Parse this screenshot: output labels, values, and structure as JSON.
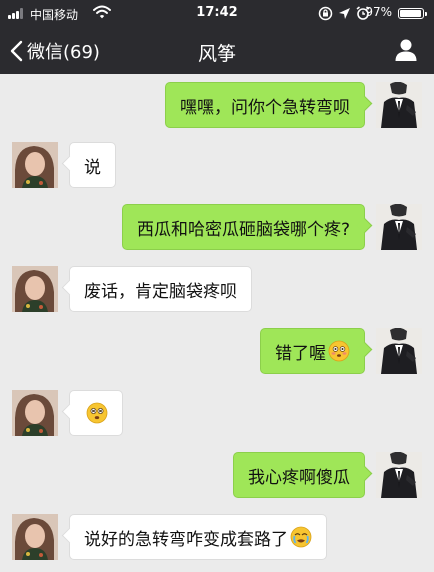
{
  "status_bar": {
    "carrier": "中国移动",
    "time": "17:42",
    "battery": "97%",
    "battery_level": 0.97,
    "icons": [
      "signal-bars-icon",
      "wifi-icon",
      "orientation-lock-icon",
      "location-arrow-icon",
      "alarm-icon",
      "battery-icon"
    ]
  },
  "nav": {
    "back_label": "微信(69)",
    "back_icon": "chevron-left-icon",
    "title": "风筝",
    "profile_icon": "person-icon"
  },
  "colors": {
    "nav_background": "#2b2b2f",
    "chat_background": "#ebebeb",
    "sent_bubble": "#9fe658",
    "received_bubble": "#ffffff"
  },
  "messages": [
    {
      "side": "right",
      "text": "嘿嘿，问你个急转弯呗",
      "emoji": ""
    },
    {
      "side": "left",
      "text": "说",
      "emoji": ""
    },
    {
      "side": "right",
      "text": "西瓜和哈密瓜砸脑袋哪个疼?",
      "emoji": ""
    },
    {
      "side": "left",
      "text": "废话，肯定脑袋疼呗",
      "emoji": ""
    },
    {
      "side": "right",
      "text": "错了喔",
      "emoji": "flushed-face-emoji"
    },
    {
      "side": "left",
      "text": "",
      "emoji": "dizzy-face-emoji"
    },
    {
      "side": "right",
      "text": "我心疼啊傻瓜",
      "emoji": ""
    },
    {
      "side": "left",
      "text": "说好的急转弯咋变成套路了",
      "emoji": "crying-face-emoji"
    }
  ]
}
